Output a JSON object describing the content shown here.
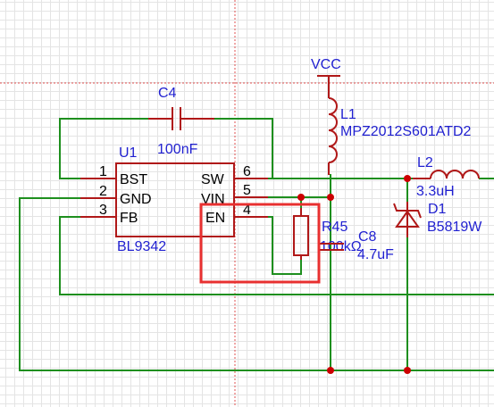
{
  "colors": {
    "wire": "#1e8f1e",
    "component": "#b01818",
    "label": "#1f1fd0",
    "pin_text": "#000000",
    "junction": "#cc0000",
    "selection": "#e83030",
    "grid": "#e4e4e4",
    "crosshair": "#e05050"
  },
  "net_labels": {
    "vcc": "VCC"
  },
  "u1": {
    "designator": "U1",
    "part": "BL9342",
    "pins": [
      {
        "num": "1",
        "name": "BST"
      },
      {
        "num": "2",
        "name": "GND"
      },
      {
        "num": "3",
        "name": "FB"
      },
      {
        "num": "6",
        "name": "SW"
      },
      {
        "num": "5",
        "name": "VIN"
      },
      {
        "num": "4",
        "name": "EN"
      }
    ]
  },
  "c4": {
    "designator": "C4",
    "value": "100nF"
  },
  "l1": {
    "designator": "L1",
    "value": "MPZ2012S601ATD2"
  },
  "l2": {
    "designator": "L2",
    "value": "3.3uH"
  },
  "d1": {
    "designator": "D1",
    "value": "B5819W"
  },
  "r45": {
    "designator": "R45",
    "value": "100kΩ"
  },
  "c8": {
    "designator": "C8",
    "value": "4.7uF"
  }
}
